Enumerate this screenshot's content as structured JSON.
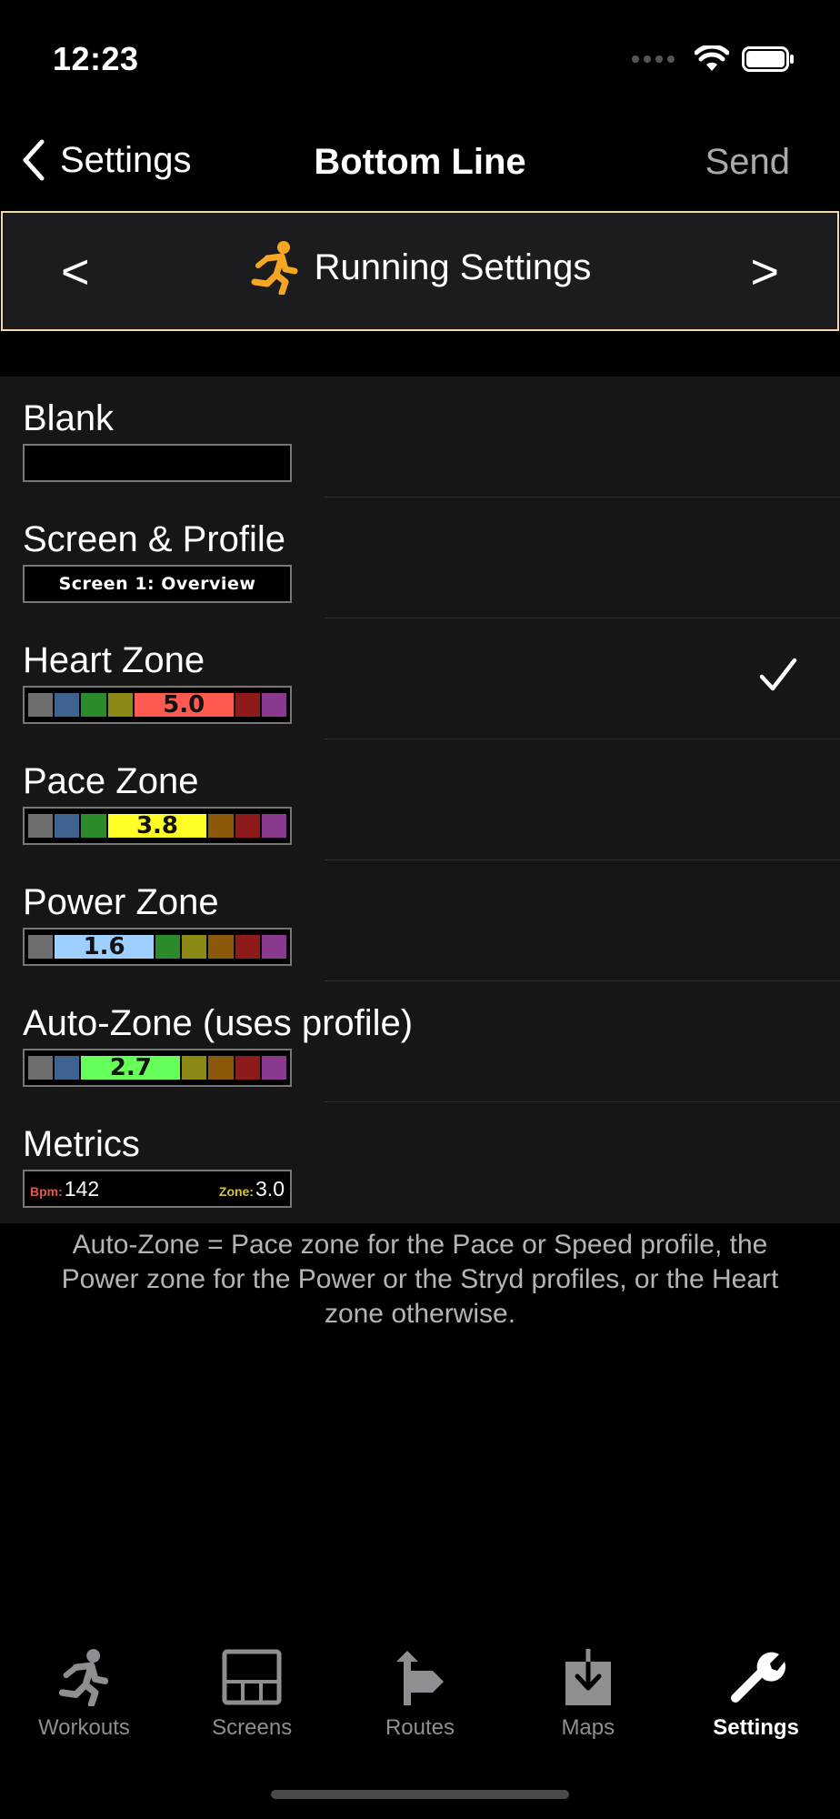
{
  "status_bar": {
    "time": "12:23"
  },
  "nav": {
    "back_label": "Settings",
    "title": "Bottom Line",
    "send_label": "Send"
  },
  "profile": {
    "prev": "<",
    "next": ">",
    "name": "Running Settings",
    "icon": "running-person-icon",
    "icon_color": "#f5a623"
  },
  "options": [
    {
      "label": "Blank",
      "preview": "blank",
      "selected": false
    },
    {
      "label": "Screen & Profile",
      "preview": "text",
      "text": "Screen 1: Overview",
      "selected": false
    },
    {
      "label": "Heart Zone",
      "preview": "zones",
      "active_index": 4,
      "active_value": "5.0",
      "active_color": "#ff5a4f",
      "selected": true
    },
    {
      "label": "Pace Zone",
      "preview": "zones",
      "active_index": 3,
      "active_value": "3.8",
      "active_color": "#ffff26",
      "selected": false
    },
    {
      "label": "Power Zone",
      "preview": "zones",
      "active_index": 1,
      "active_value": "1.6",
      "active_color": "#9dd0ff",
      "selected": false
    },
    {
      "label": "Auto-Zone (uses profile)",
      "preview": "zones",
      "active_index": 2,
      "active_value": "2.7",
      "active_color": "#66ff5a",
      "selected": false
    },
    {
      "label": "Metrics",
      "preview": "metrics",
      "metrics": [
        {
          "label": "Bpm:",
          "value": "142",
          "color": "#e0584a"
        },
        {
          "label": "Zone:",
          "value": "3.0",
          "color": "#d8c23a"
        }
      ],
      "selected": false
    }
  ],
  "zone_colors": [
    "#6e6e6e",
    "#3f6391",
    "#2b8a2b",
    "#8c8a16",
    "#8a5a0a",
    "#8e1a1c",
    "#8a3a8e"
  ],
  "footnote": "Auto-Zone = Pace zone for the Pace or Speed profile, the Power zone for the Power or the Stryd profiles, or the Heart zone otherwise.",
  "tabs": [
    {
      "label": "Workouts",
      "icon": "running-person-icon",
      "active": false
    },
    {
      "label": "Screens",
      "icon": "screen-grid-icon",
      "active": false
    },
    {
      "label": "Routes",
      "icon": "route-sign-icon",
      "active": false
    },
    {
      "label": "Maps",
      "icon": "map-download-icon",
      "active": false
    },
    {
      "label": "Settings",
      "icon": "wrench-icon",
      "active": true
    }
  ]
}
